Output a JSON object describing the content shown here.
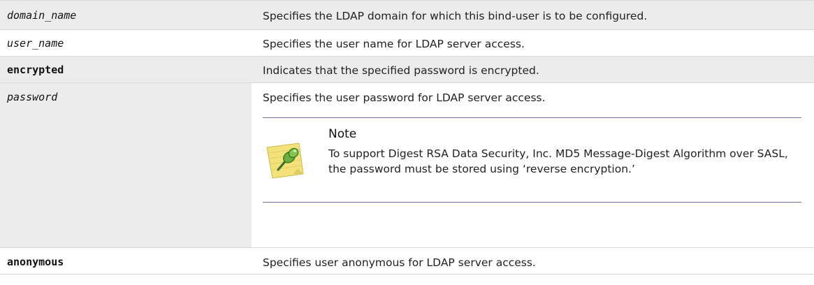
{
  "rows": [
    {
      "term": "domain_name",
      "description": "Specifies the LDAP domain for which this bind-user is to be configured."
    },
    {
      "term": "user_name",
      "description": "Specifies the user name for LDAP server access."
    },
    {
      "term": "encrypted",
      "description": "Indicates that the specified password is encrypted."
    },
    {
      "term": "password",
      "description": "Specifies the user password for LDAP server access.",
      "note": {
        "heading": "Note",
        "body": "To support Digest RSA Data Security, Inc. MD5 Message-Digest Algorithm over SASL, the password must be stored using ‘reverse encryption.’",
        "icon": "sticky-note-pin-icon"
      }
    },
    {
      "term": "anonymous",
      "description": "Specifies user anonymous for LDAP server access."
    }
  ]
}
